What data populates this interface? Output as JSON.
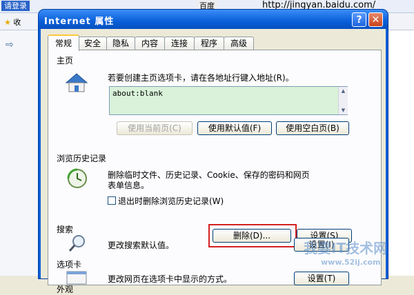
{
  "background": {
    "login_button": "请登录",
    "baidu_label": "百度",
    "url_text": "http://jingyan.baidu.com/",
    "favorites_label": "收"
  },
  "dialog": {
    "title": "Internet 属性",
    "help_label": "?",
    "close_label": "✕"
  },
  "tabs": [
    {
      "label": "常规",
      "active": true
    },
    {
      "label": "安全"
    },
    {
      "label": "隐私"
    },
    {
      "label": "内容"
    },
    {
      "label": "连接"
    },
    {
      "label": "程序"
    },
    {
      "label": "高级"
    }
  ],
  "homepage": {
    "section_label": "主页",
    "description": "若要创建主页选项卡，请在各地址行键入地址(R)。",
    "value": "about:blank",
    "use_current_label": "使用当前页(C)",
    "use_default_label": "使用默认值(F)",
    "use_blank_label": "使用空白页(B)"
  },
  "history": {
    "section_label": "浏览历史记录",
    "description_line1": "删除临时文件、历史记录、Cookie、保存的密码和网页",
    "description_line2": "表单信息。",
    "checkbox_label": "退出时删除浏览历史记录(W)",
    "delete_label": "删除(D)...",
    "settings_label": "设置(S)"
  },
  "search": {
    "section_label": "搜索",
    "description": "更改搜索默认值。",
    "settings_label": "设置(I)"
  },
  "tabs_section": {
    "section_label": "选项卡",
    "description": "更改网页在选项卡中显示的方式。",
    "settings_label": "设置(T)"
  },
  "appearance": {
    "section_label": "外观"
  },
  "watermark": {
    "line1": "我要IT技术网",
    "line2": "www.52ij.com"
  },
  "colors": {
    "titlebar": "#0a5fd9",
    "highlight": "#d42020",
    "address_bg": "#d9f2d9"
  }
}
